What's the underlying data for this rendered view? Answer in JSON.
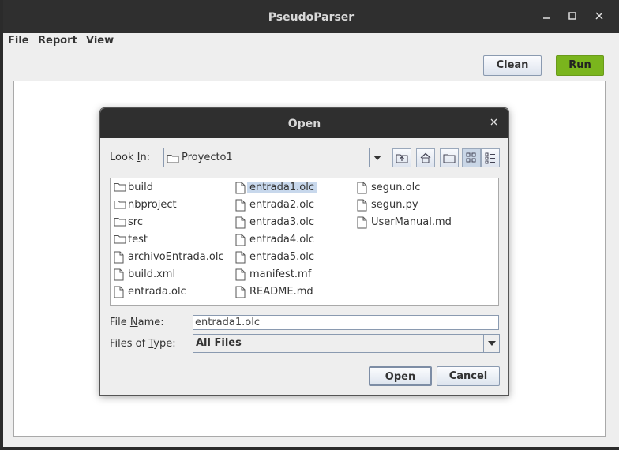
{
  "window": {
    "title": "PseudoParser",
    "minimize": "_",
    "maximize": "☐",
    "close": "✕"
  },
  "menu": {
    "file": "File",
    "report": "Report",
    "view": "View"
  },
  "toolbar": {
    "clean_label": "Clean",
    "run_label": "Run",
    "run_color": "#7ab51d"
  },
  "dialog": {
    "title": "Open",
    "close": "✕",
    "look_in_label_pre": "Look ",
    "look_in_label_key": "I",
    "look_in_label_post": "n:",
    "look_in_value": "Proyecto1",
    "toolbar_icons": [
      "up-one-level-icon",
      "home-icon",
      "new-folder-icon",
      "list-view-icon",
      "details-view-icon"
    ],
    "files": [
      {
        "name": "build",
        "kind": "folder"
      },
      {
        "name": "nbproject",
        "kind": "folder"
      },
      {
        "name": "src",
        "kind": "folder"
      },
      {
        "name": "test",
        "kind": "folder"
      },
      {
        "name": "archivoEntrada.olc",
        "kind": "file"
      },
      {
        "name": "build.xml",
        "kind": "file"
      },
      {
        "name": "entrada.olc",
        "kind": "file"
      },
      {
        "name": "entrada1.olc",
        "kind": "file",
        "selected": true
      },
      {
        "name": "entrada2.olc",
        "kind": "file"
      },
      {
        "name": "entrada3.olc",
        "kind": "file"
      },
      {
        "name": "entrada4.olc",
        "kind": "file"
      },
      {
        "name": "entrada5.olc",
        "kind": "file"
      },
      {
        "name": "manifest.mf",
        "kind": "file"
      },
      {
        "name": "README.md",
        "kind": "file"
      },
      {
        "name": "segun.olc",
        "kind": "file"
      },
      {
        "name": "segun.py",
        "kind": "file"
      },
      {
        "name": "UserManual.md",
        "kind": "file"
      }
    ],
    "file_name_label_pre": "File ",
    "file_name_label_key": "N",
    "file_name_label_post": "ame:",
    "file_name_value": "entrada1.olc",
    "files_of_type_label_pre": "Files of ",
    "files_of_type_label_key": "T",
    "files_of_type_label_post": "ype:",
    "files_of_type_value": "All Files",
    "open_label": "Open",
    "cancel_label": "Cancel"
  }
}
